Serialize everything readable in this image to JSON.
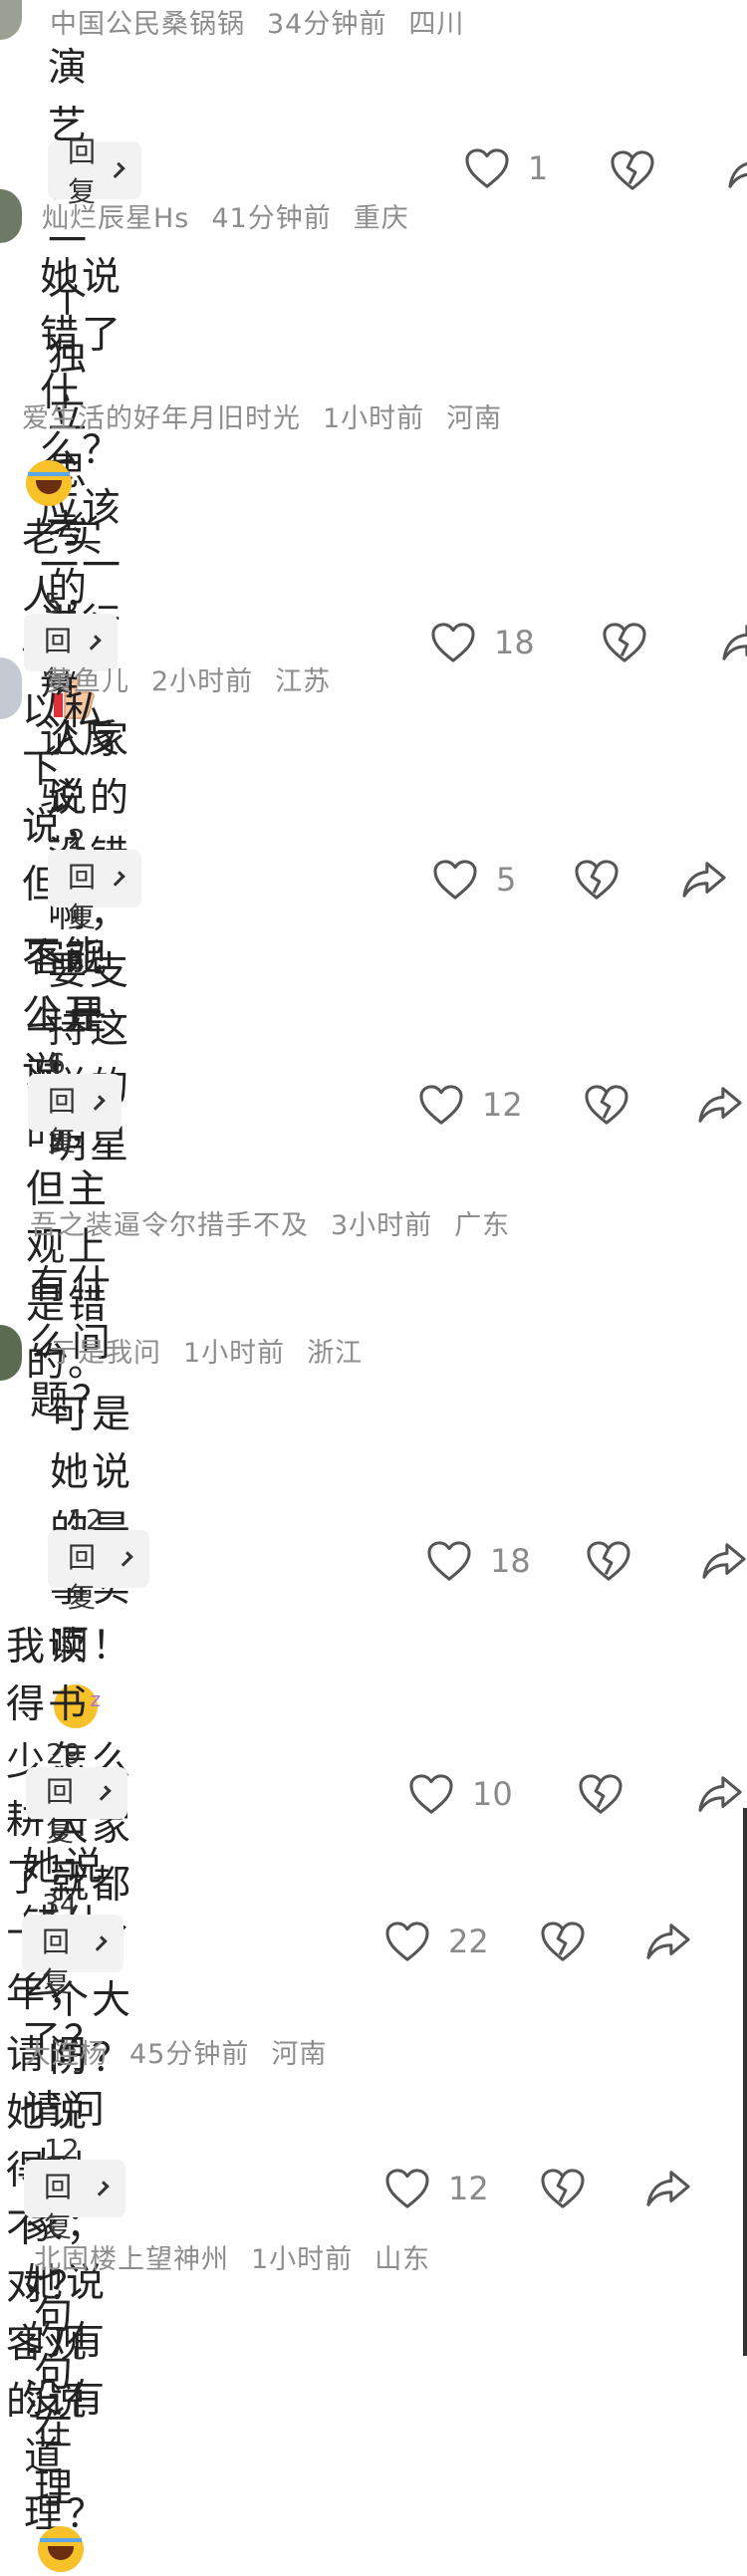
{
  "comments": [
    {
      "user": "中国公民桑锅锅",
      "time": "34分钟前",
      "region": "四川",
      "text": "演艺界一个独立思考的人",
      "reply": "回复",
      "likes": "1"
    },
    {
      "user": "灿烂辰星Hs",
      "time": "41分钟前",
      "region": "重庆",
      "text_l1": "她说错了什么？应该一一进行辩",
      "text_l2": "论反驳"
    },
    {
      "user": "爱生活的好年月旧时光",
      "time": "1小时前",
      "region": "河南",
      "text_l1": "老实人，你可以私下说，但",
      "text_l2": "不能公开说",
      "reply": "5回复",
      "likes": "18"
    },
    {
      "user": "黄鱼儿",
      "time": "2小时前",
      "region": "江苏",
      "text_l1": "人家说的没错啊，要支持这样的",
      "text_l2": "明星",
      "reply": "2回复",
      "likes": "5"
    },
    {
      "text_l1": "客观上是对的，但主观上是错",
      "text_l2": "的。",
      "reply": "6回复",
      "likes": "12"
    },
    {
      "user": "吾之装逼令尔措手不及",
      "time": "3小时前",
      "region": "广东",
      "text": "有什么问题？"
    },
    {
      "user": "亍是我问",
      "time": "1小时前",
      "region": "浙江",
      "text_l1a": "可是她说的是事实啊！",
      "text_l1b": "怎么",
      "text_l2": "大家就都破了个大防？",
      "reply": "12回复",
      "likes": "18"
    },
    {
      "text_l1": "我读得书少，耕田了三十多年，",
      "text_l2": "请问她说得对不对？客观的说",
      "reply": "29回复",
      "likes": "10"
    },
    {
      "text": "她说错什么了？",
      "reply": "34回复",
      "likes": "22"
    },
    {
      "user": "大连杨",
      "time": "45分钟前",
      "region": "河南",
      "text": "请问大家；她说的有没有道理？",
      "reply": "12回复",
      "likes": "12"
    },
    {
      "user": "北固楼上望神州",
      "time": "1小时前",
      "region": "山东",
      "text": "句句在理"
    }
  ],
  "icons": {
    "like": "heart-outline-icon",
    "dislike": "broken-heart-icon",
    "share": "share-arrow-icon",
    "chevron": "chevron-right-icon"
  }
}
